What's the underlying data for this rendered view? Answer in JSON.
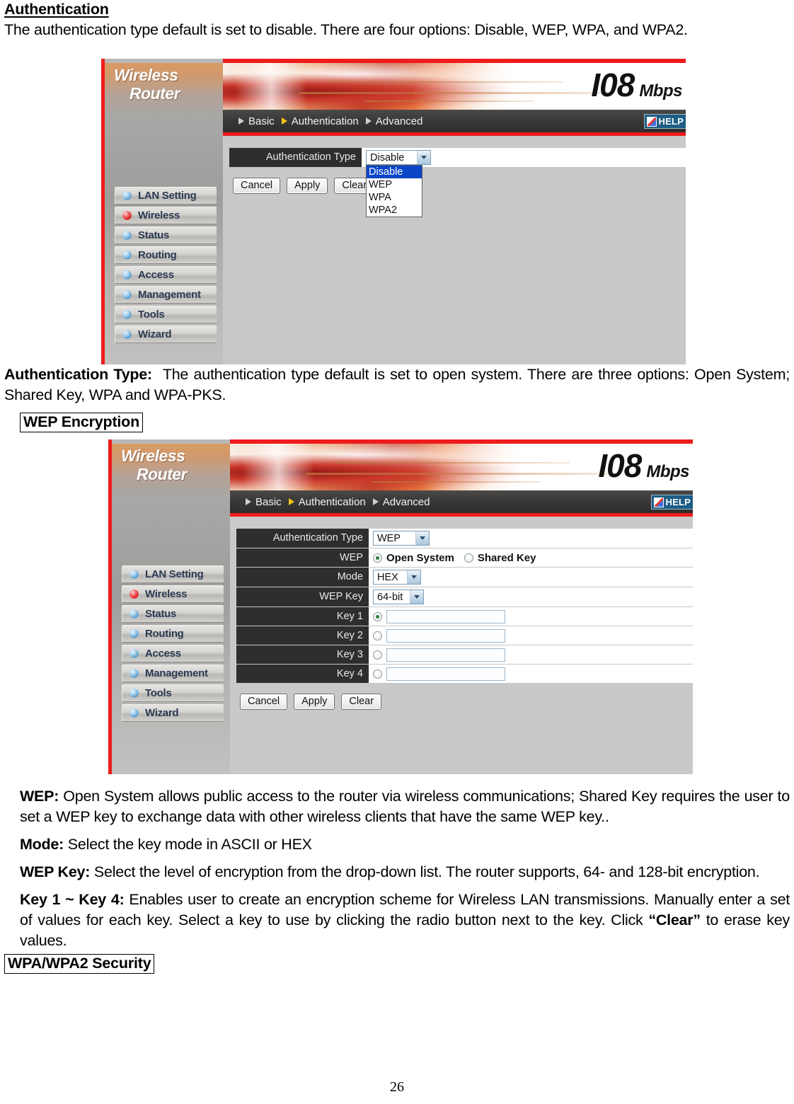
{
  "document": {
    "heading": "Authentication",
    "intro_paragraph": "The authentication type default is set to disable. There are four options: Disable, WEP, WPA, and WPA2.",
    "auth_type_label": "Authentication Type:",
    "auth_type_body": "The authentication type default is set to open system.   There are three options: Open System; Shared Key, WPA and WPA-PKS.",
    "wep_encryption_heading": "WEP Encryption",
    "wep_label": "WEP:",
    "wep_body": "Open System allows public access to the router via wireless communications; Shared Key requires the user to set a WEP key to exchange data with other wireless clients that have the same WEP key..",
    "mode_label": "Mode:",
    "mode_body": "Select the key mode in ASCII or HEX",
    "wep_key_label": "WEP Key:",
    "wep_key_body": "Select the level of encryption from the drop-down list. The router supports, 64- and 128-bit encryption.",
    "key_range_label": "Key 1 ~ Key 4:",
    "key_range_body_1": "Enables user to create an encryption scheme for Wireless LAN transmissions. Manually enter a set of values for each key. Select a key to use by clicking the radio button next to the key. Click ",
    "key_range_quote": "“Clear”",
    "key_range_body_2": " to erase key values.",
    "wpa_heading": "WPA/WPA2 Security",
    "page_number": "26"
  },
  "router_ui": {
    "brand_line1": "Wireless",
    "brand_line2": "Router",
    "logo_number": "I08",
    "logo_unit": "Mbps",
    "help_label": "HELP",
    "tabs": [
      {
        "label": "Basic",
        "active": false
      },
      {
        "label": "Authentication",
        "active": true
      },
      {
        "label": "Advanced",
        "active": false
      }
    ],
    "nav_items": [
      {
        "label": "LAN Setting",
        "state": "normal"
      },
      {
        "label": "Wireless",
        "state": "active"
      },
      {
        "label": "Status",
        "state": "normal"
      },
      {
        "label": "Routing",
        "state": "normal"
      },
      {
        "label": "Access",
        "state": "normal"
      },
      {
        "label": "Management",
        "state": "normal"
      },
      {
        "label": "Tools",
        "state": "normal"
      },
      {
        "label": "Wizard",
        "state": "normal"
      }
    ],
    "buttons": {
      "cancel": "Cancel",
      "apply": "Apply",
      "clear": "Clear"
    },
    "colors": {
      "accent_red": "#ee1c1c",
      "tabbar_dark": "#2d2c2a",
      "label_cell": "#2e2e2e",
      "dropdown_highlight": "#0a46c8",
      "nav_label": "#2b3a52"
    },
    "screen_disable": {
      "auth_type_row_label": "Authentication Type",
      "auth_type_value": "Disable",
      "dropdown_open": true,
      "dropdown_options": [
        "Disable",
        "WEP",
        "WPA",
        "WPA2"
      ],
      "dropdown_selected": "Disable"
    },
    "screen_wep": {
      "rows": {
        "auth_type_label": "Authentication Type",
        "auth_type_value": "WEP",
        "wep_label": "WEP",
        "wep_option_open": "Open System",
        "wep_option_shared": "Shared Key",
        "wep_selected": "Open System",
        "mode_label": "Mode",
        "mode_value": "HEX",
        "wep_key_label": "WEP Key",
        "wep_key_value": "64-bit",
        "key1_label": "Key 1",
        "key1_value": "",
        "key2_label": "Key 2",
        "key2_value": "",
        "key3_label": "Key 3",
        "key3_value": "",
        "key4_label": "Key 4",
        "key4_value": "",
        "key_selected": "Key 1"
      }
    }
  }
}
